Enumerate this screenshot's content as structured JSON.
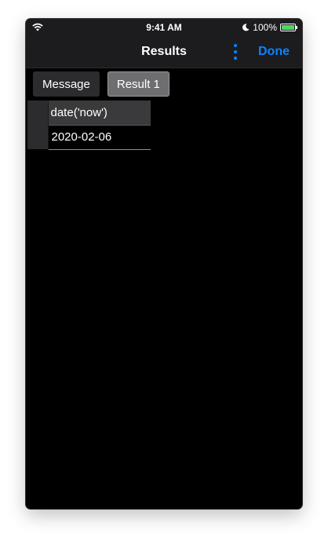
{
  "status_bar": {
    "time": "9:41 AM",
    "battery_percent": "100%",
    "battery_level": 1.0,
    "icons": [
      "wifi-icon",
      "moon-icon",
      "battery-icon"
    ]
  },
  "navbar": {
    "title": "Results",
    "done_label": "Done",
    "more_icon": "more-vertical-icon"
  },
  "tabs": [
    {
      "label": "Message",
      "active": false
    },
    {
      "label": "Result 1",
      "active": true
    }
  ],
  "result_table": {
    "columns": [
      "date('now')"
    ],
    "rows": [
      [
        "2020-02-06"
      ]
    ]
  },
  "colors": {
    "accent": "#0a84ff",
    "background": "#000000",
    "bar": "#1c1c1e",
    "battery_fill": "#4cd964"
  }
}
